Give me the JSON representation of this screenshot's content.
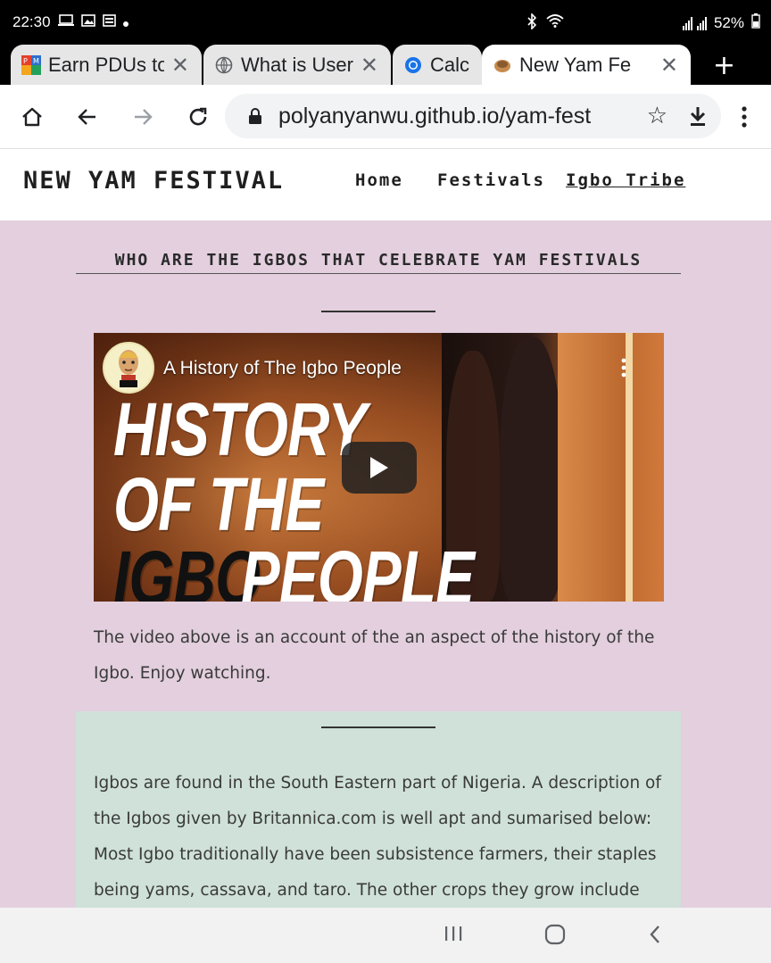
{
  "status_bar": {
    "time": "22:30",
    "battery": "52%"
  },
  "tabs": [
    {
      "title": "Earn PDUs to",
      "favicon": "pmi-icon",
      "active": false
    },
    {
      "title": "What is User",
      "favicon": "globe-icon",
      "active": false
    },
    {
      "title": "Calc",
      "favicon": "blue-circle-icon",
      "active": false
    },
    {
      "title": "New Yam Fe",
      "favicon": "yam-icon",
      "active": true
    }
  ],
  "toolbar": {
    "url": "polyanyanwu.github.io/yam-fest"
  },
  "site_nav": {
    "brand": "NEW YAM FESTIVAL",
    "links": [
      "Home",
      "Festivals",
      "Igbo Tribe"
    ]
  },
  "content": {
    "heading": "WHO ARE THE IGBOS THAT CELEBRATE YAM FESTIVALS",
    "video": {
      "title": "A History of The Igbo People",
      "thumb_line1": "HISTORY",
      "thumb_line2": "OF THE",
      "thumb_line3a": "IGBO",
      "thumb_line3b": "PEOPLE"
    },
    "video_caption_1": "The video above is an account of the an aspect of the history of the",
    "video_caption_2": "Igbo. Enjoy watching.",
    "green_lines": [
      "Igbos are found in the South Eastern part of Nigeria. A description of",
      "the Igbos given by Britannica.com is well apt and sumarised below:",
      "Most Igbo traditionally have been subsistence farmers, their staples",
      "being yams, cassava, and taro. The other crops they grow include corn"
    ]
  },
  "colors": {
    "content_bg": "#e3cfde",
    "green_box": "#cfe1d8"
  }
}
